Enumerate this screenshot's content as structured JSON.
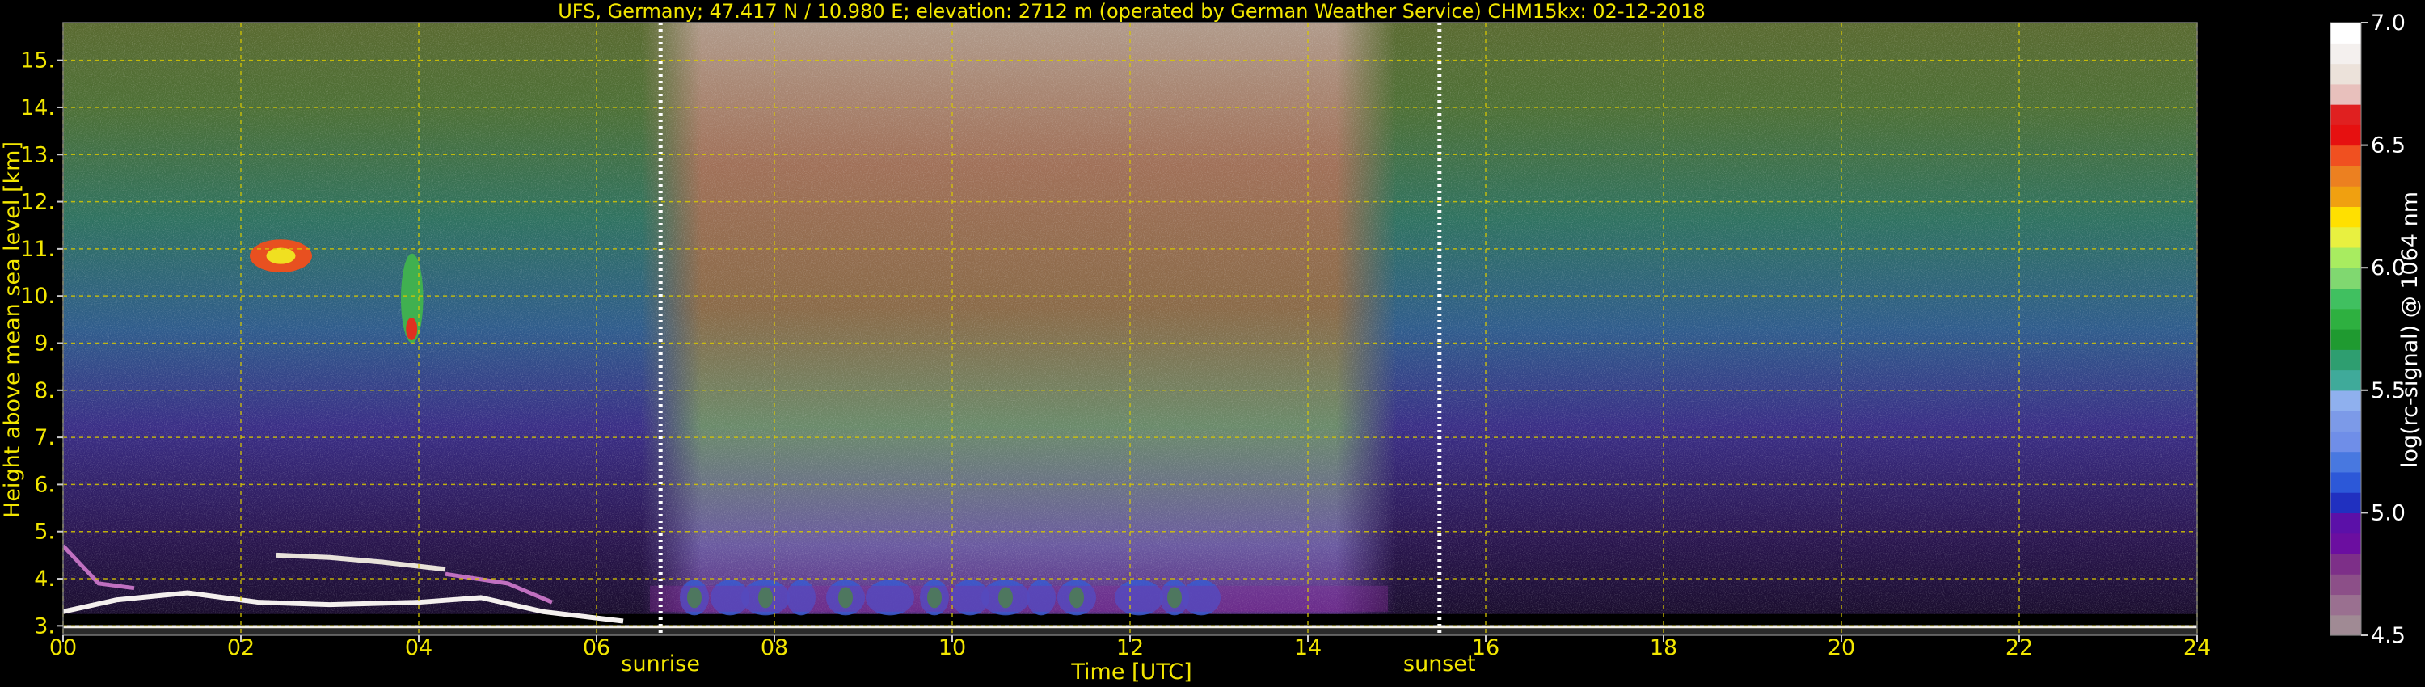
{
  "chart_data": {
    "type": "heatmap",
    "title": "UFS, Germany; 47.417 N / 10.980 E; elevation: 2712 m  (operated by German Weather Service)    CHM15kx: 02-12-2018",
    "xlabel": "Time [UTC]",
    "ylabel": "Height above mean sea level [km]",
    "xlim": [
      0,
      24
    ],
    "ylim": [
      2.8,
      15.8
    ],
    "x_ticks": [
      "00",
      "02",
      "04",
      "06",
      "08",
      "10",
      "12",
      "14",
      "16",
      "18",
      "20",
      "22",
      "24"
    ],
    "y_ticks": [
      "3.",
      "4.",
      "5.",
      "6.",
      "7.",
      "8.",
      "9.",
      "10.",
      "11.",
      "12.",
      "13.",
      "14.",
      "15."
    ],
    "grid": true,
    "colorbar": {
      "label": "log(rc-signal) @ 1064 nm",
      "range": [
        4.5,
        7.0
      ],
      "ticks": [
        "4.5",
        "5.0",
        "5.5",
        "6.0",
        "6.5",
        "7.0"
      ],
      "colors": [
        "#a08a94",
        "#9a7090",
        "#8c4f88",
        "#7d2f88",
        "#6b0ea0",
        "#5b10a8",
        "#2030c0",
        "#2c58d8",
        "#4878e0",
        "#6f8ee8",
        "#7c9ae8",
        "#8fb0ee",
        "#3faa9a",
        "#2e9e70",
        "#1f9a30",
        "#2eb040",
        "#40c060",
        "#80d870",
        "#a8ec60",
        "#e8f040",
        "#ffe000",
        "#f0a010",
        "#ec8020",
        "#f05020",
        "#e61010",
        "#e02020",
        "#e8c0bc",
        "#ece2da",
        "#f4f0ee",
        "#ffffff"
      ]
    },
    "annotations": [
      {
        "text": "sunrise",
        "x": 6.72
      },
      {
        "text": "sunset",
        "x": 15.48
      }
    ],
    "regions": [
      {
        "name": "daytime high background",
        "x": [
          6.5,
          15.0
        ],
        "y": [
          3.2,
          15.8
        ]
      },
      {
        "name": "cirrus cloud",
        "x": [
          2.1,
          2.8
        ],
        "y": [
          10.5,
          11.2
        ]
      },
      {
        "name": "cirrus cloud",
        "x": [
          3.8,
          4.05
        ],
        "y": [
          9.0,
          10.9
        ]
      },
      {
        "name": "boundary layer top",
        "x": [
          0,
          6.5
        ],
        "y": [
          3.2,
          4.6
        ]
      }
    ]
  }
}
